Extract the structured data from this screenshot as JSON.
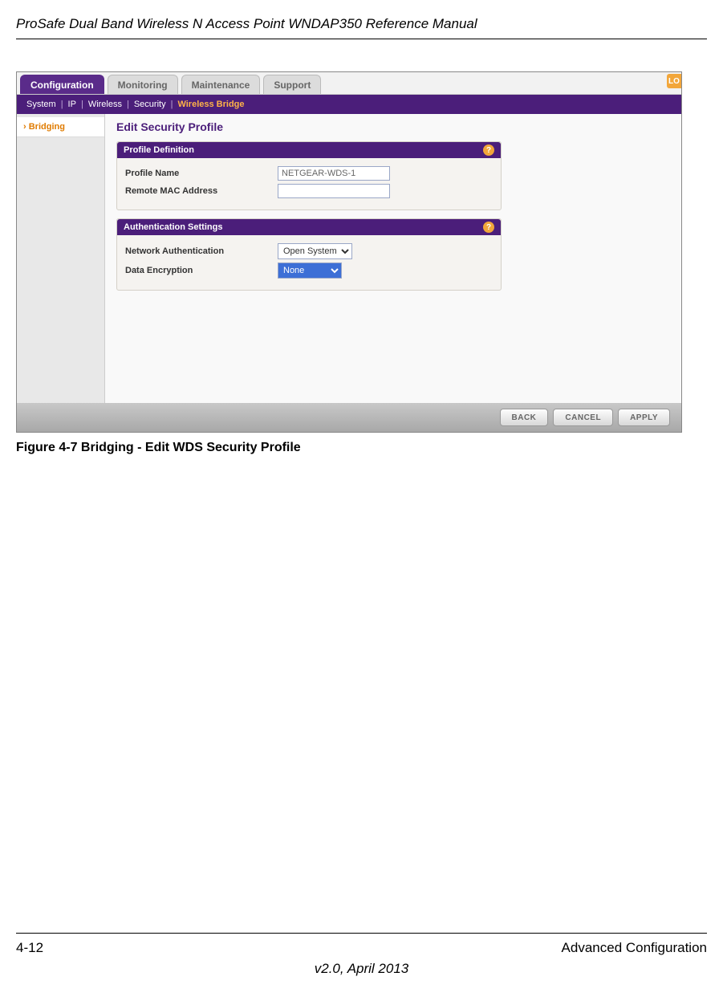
{
  "doc": {
    "title": "ProSafe Dual Band Wireless N Access Point WNDAP350 Reference Manual",
    "figure_caption": "Figure 4-7  Bridging - Edit WDS Security Profile",
    "page_number": "4-12",
    "section_name": "Advanced Configuration",
    "version_line": "v2.0, April 2013"
  },
  "screenshot": {
    "main_tabs": [
      "Configuration",
      "Monitoring",
      "Maintenance",
      "Support"
    ],
    "active_main_tab_index": 0,
    "lo_badge": "LO",
    "sub_nav": [
      "System",
      "IP",
      "Wireless",
      "Security",
      "Wireless Bridge"
    ],
    "active_sub_nav_index": 4,
    "sidebar": {
      "items": [
        "› Bridging"
      ]
    },
    "panel_title": "Edit Security Profile",
    "sections": {
      "profile_def": {
        "title": "Profile Definition",
        "rows": {
          "name_label": "Profile Name",
          "name_value": "NETGEAR-WDS-1",
          "mac_label": "Remote MAC Address",
          "mac_value": ""
        }
      },
      "auth": {
        "title": "Authentication Settings",
        "rows": {
          "net_auth_label": "Network Authentication",
          "net_auth_value": "Open System",
          "enc_label": "Data Encryption",
          "enc_value": "None"
        }
      }
    },
    "buttons": {
      "back": "BACK",
      "cancel": "CANCEL",
      "apply": "APPLY"
    },
    "help_char": "?"
  }
}
